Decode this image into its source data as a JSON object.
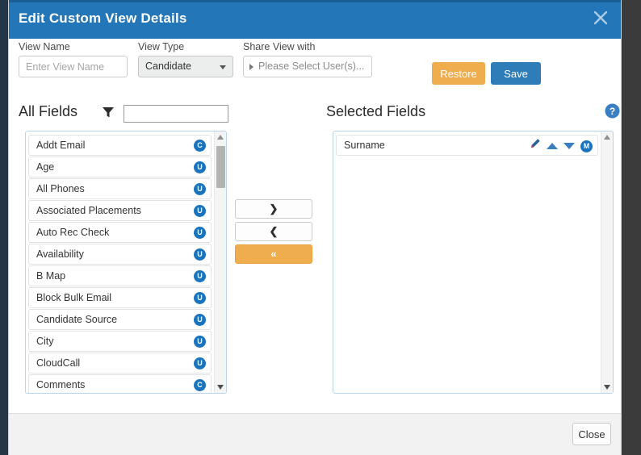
{
  "dialog": {
    "title": "Edit Custom View Details",
    "close_icon": "close-x-icon"
  },
  "form": {
    "view_name": {
      "label": "View Name",
      "value": "",
      "placeholder": "Enter View Name"
    },
    "view_type": {
      "label": "View Type",
      "value": "Candidate",
      "caret_icon": "chevron-down-icon"
    },
    "share_view": {
      "label": "Share View with",
      "value": "Please Select User(s)...",
      "expand_icon": "triangle-right-icon"
    },
    "restore_label": "Restore",
    "save_label": "Save"
  },
  "all_fields": {
    "heading": "All Fields",
    "filter_icon": "funnel-icon",
    "filter_value": "",
    "items": [
      {
        "label": "Addt Email",
        "badge": "C"
      },
      {
        "label": "Age",
        "badge": "U"
      },
      {
        "label": "All Phones",
        "badge": "U"
      },
      {
        "label": "Associated Placements",
        "badge": "U"
      },
      {
        "label": "Auto Rec Check",
        "badge": "U"
      },
      {
        "label": "Availability",
        "badge": "U"
      },
      {
        "label": "B Map",
        "badge": "U"
      },
      {
        "label": "Block Bulk Email",
        "badge": "U"
      },
      {
        "label": "Candidate Source",
        "badge": "U"
      },
      {
        "label": "City",
        "badge": "U"
      },
      {
        "label": "CloudCall",
        "badge": "U"
      },
      {
        "label": "Comments",
        "badge": "C"
      }
    ]
  },
  "transfer": {
    "add_label": "❯",
    "remove_label": "❮",
    "remove_all_label": "«"
  },
  "selected_fields": {
    "heading": "Selected Fields",
    "help_icon": "help-circle-icon",
    "items": [
      {
        "label": "Surname",
        "edit_icon": "pencil-icon",
        "move_up_icon": "triangle-up-icon",
        "move_down_icon": "triangle-down-icon",
        "badge": "M"
      }
    ]
  },
  "footer": {
    "close_label": "Close"
  },
  "colors": {
    "titlebar": "#2376b7",
    "accent_blue": "#2e7cb8",
    "accent_orange": "#f0ad4e",
    "badge_blue": "#1a74bd",
    "panel_border": "#b9d3ea"
  }
}
